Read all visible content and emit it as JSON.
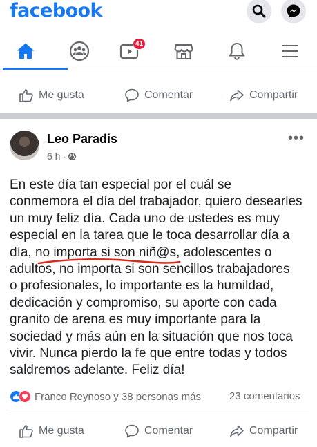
{
  "header": {
    "brand": "facebook",
    "search_icon": "search-icon",
    "messenger_icon": "messenger-icon"
  },
  "nav": {
    "items": [
      {
        "name": "home",
        "icon": "home-icon",
        "active": true
      },
      {
        "name": "groups",
        "icon": "groups-icon"
      },
      {
        "name": "watch",
        "icon": "video-icon",
        "badge": "41"
      },
      {
        "name": "marketplace",
        "icon": "marketplace-icon"
      },
      {
        "name": "notifications",
        "icon": "bell-icon"
      },
      {
        "name": "menu",
        "icon": "hamburger-menu-icon"
      }
    ],
    "accent": "#1877f2"
  },
  "top_actions": {
    "like": "Me gusta",
    "comment": "Comentar",
    "share": "Compartir"
  },
  "post": {
    "author": "Leo Paradis",
    "time": "6 h",
    "privacy_icon": "globe-icon",
    "body": [
      "En este día tan especial por el cuál se",
      "conmemora el día del trabajador, quiero desearles",
      "un muy feliz día. Cada uno de  ustedes es muy",
      "especial en la tarea que le toca desarrollar día a",
      "día, no importa si son niñ@s, adolescentes o",
      "adultos, no importa si son sencillos trabajadores",
      "o profesionales,  lo importante es la humildad,",
      "dedicación y  compromiso, su aporte con cada",
      "granito de arena es muy importante para la",
      "sociedad y más  aún en la situación que nos toca",
      "vivir. Nunca pierdo la fe que entre todas y todos",
      "saldremos adelante. Feliz día!"
    ],
    "reactions_text": "Franco Reynoso y 38 personas más",
    "comments_count": "23 comentarios"
  },
  "bottom_actions": {
    "like": "Me gusta",
    "comment": "Comentar",
    "share": "Compartir"
  },
  "colors": {
    "like_blue": "#1877f2",
    "love_red": "#f33e58",
    "annotation_red": "#d62a1e"
  }
}
